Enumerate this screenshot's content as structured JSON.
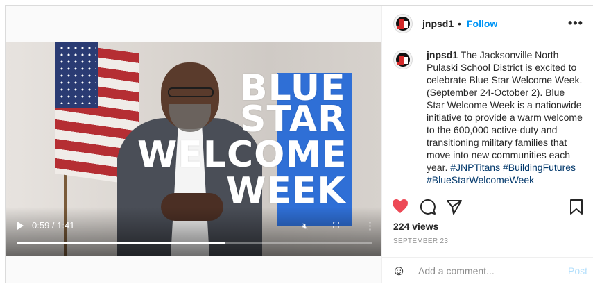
{
  "post": {
    "username": "jnpsd1",
    "follow_label": "Follow",
    "separator": "•",
    "more_label": "•••",
    "caption": {
      "username": "jnpsd1",
      "text": "The Jacksonville North Pulaski School District is excited to celebrate Blue Star Welcome Week. (September 24-October 2). Blue Star Welcome Week is a nationwide initiative to provide a warm welcome to the 600,000 active-duty and transitioning military families that move into new communities each year.",
      "hashtags": "#JNPTitans #BuildingFutures #BlueStarWelcomeWeek"
    },
    "views": "224 views",
    "date": "SEPTEMBER 23"
  },
  "video": {
    "overlay_lines": [
      "BLUE",
      "STAR",
      "WELCOME",
      "WEEK"
    ],
    "time": "0:59 / 1:41",
    "progress": 0.585,
    "colors": {
      "blue_box": "#2f6fd6"
    }
  },
  "actions": {
    "like_icon": "heart-filled-icon",
    "comment_icon": "comment-bubble-icon",
    "share_icon": "paper-plane-icon",
    "save_icon": "bookmark-icon",
    "like_color": "#ed4956"
  },
  "comment": {
    "placeholder": "Add a comment...",
    "post_label": "Post"
  }
}
